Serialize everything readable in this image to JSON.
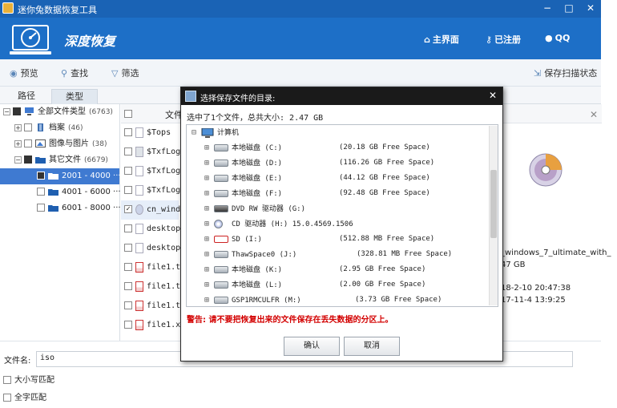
{
  "app": {
    "title": "迷你兔数据恢复工具",
    "brand": "深度恢复"
  },
  "nav": {
    "home": "主界面",
    "registered": "已注册",
    "qq": "QQ"
  },
  "toolbar": {
    "preview": "预览",
    "find": "查找",
    "filter": "筛选",
    "save_scan": "保存扫描状态"
  },
  "tabs": [
    {
      "label": "路径"
    },
    {
      "label": "类型"
    }
  ],
  "tree": [
    {
      "label": "全部文件类型",
      "count": "(6763)"
    },
    {
      "label": "档案",
      "count": "(46)"
    },
    {
      "label": "图像与图片",
      "count": "(38)"
    },
    {
      "label": "其它文件",
      "count": "(6679)"
    },
    {
      "label": "2001 - 4000 ···",
      "count": ""
    },
    {
      "label": "4001 - 6000 ···",
      "count": ""
    },
    {
      "label": "6001 - 8000 ···",
      "count": ""
    }
  ],
  "filelist": {
    "header": "文件",
    "rows": [
      {
        "name": "$Tops"
      },
      {
        "name": "$TxfLog."
      },
      {
        "name": "$TxfLogC"
      },
      {
        "name": "$TxfLogC"
      },
      {
        "name": "cn_windo"
      },
      {
        "name": "desktop."
      },
      {
        "name": "desktop."
      },
      {
        "name": "file1.tx"
      },
      {
        "name": "file1.tx"
      },
      {
        "name": "file1.tx"
      },
      {
        "name": "file1.xm"
      }
    ]
  },
  "preview_info": {
    "line1": "_windows_7_ultimate_with_",
    "line2": "47 GB",
    "line3": "18-2-10 20:47:38",
    "line4": "17-11-4 13:9:25"
  },
  "bottom": {
    "filename_label": "文件名:",
    "filename_value": "iso",
    "match_case": "大小写匹配",
    "match_whole": "全字匹配"
  },
  "dialog": {
    "title": "选择保存文件的目录:",
    "summary": "选中了1个文件，总共大小: 2.47 GB",
    "root": "计算机",
    "drives": [
      {
        "name": "本地磁盘 (C:)",
        "free": "(20.18 GB Free Space)"
      },
      {
        "name": "本地磁盘 (D:)",
        "free": "(116.26 GB Free Space)"
      },
      {
        "name": "本地磁盘 (E:)",
        "free": "(44.12 GB Free Space)"
      },
      {
        "name": "本地磁盘 (F:)",
        "free": "(92.48 GB Free Space)"
      },
      {
        "name": "DVD RW 驱动器 (G:)",
        "free": ""
      },
      {
        "name": "CD 驱动器 (H:) 15.0.4569.1506",
        "free": ""
      },
      {
        "name": "SD (I:)",
        "free": "(512.88 MB Free Space)"
      },
      {
        "name": "ThawSpace0 (J:)",
        "free": "(328.81 MB Free Space)"
      },
      {
        "name": "本地磁盘 (K:)",
        "free": "(2.95 GB Free Space)"
      },
      {
        "name": "本地磁盘 (L:)",
        "free": "(2.00 GB Free Space)"
      },
      {
        "name": "GSP1RMCULFR (M:)",
        "free": "(3.73 GB Free Space)"
      }
    ],
    "warning": "警告: 请不要把恢复出来的文件保存在丢失数据的分区上。",
    "ok": "确认",
    "cancel": "取消"
  },
  "colors": {
    "header_blue": "#1d6fc7",
    "title_blue": "#1a63b5",
    "selected": "#3f7ad1",
    "warning": "#d30000"
  }
}
